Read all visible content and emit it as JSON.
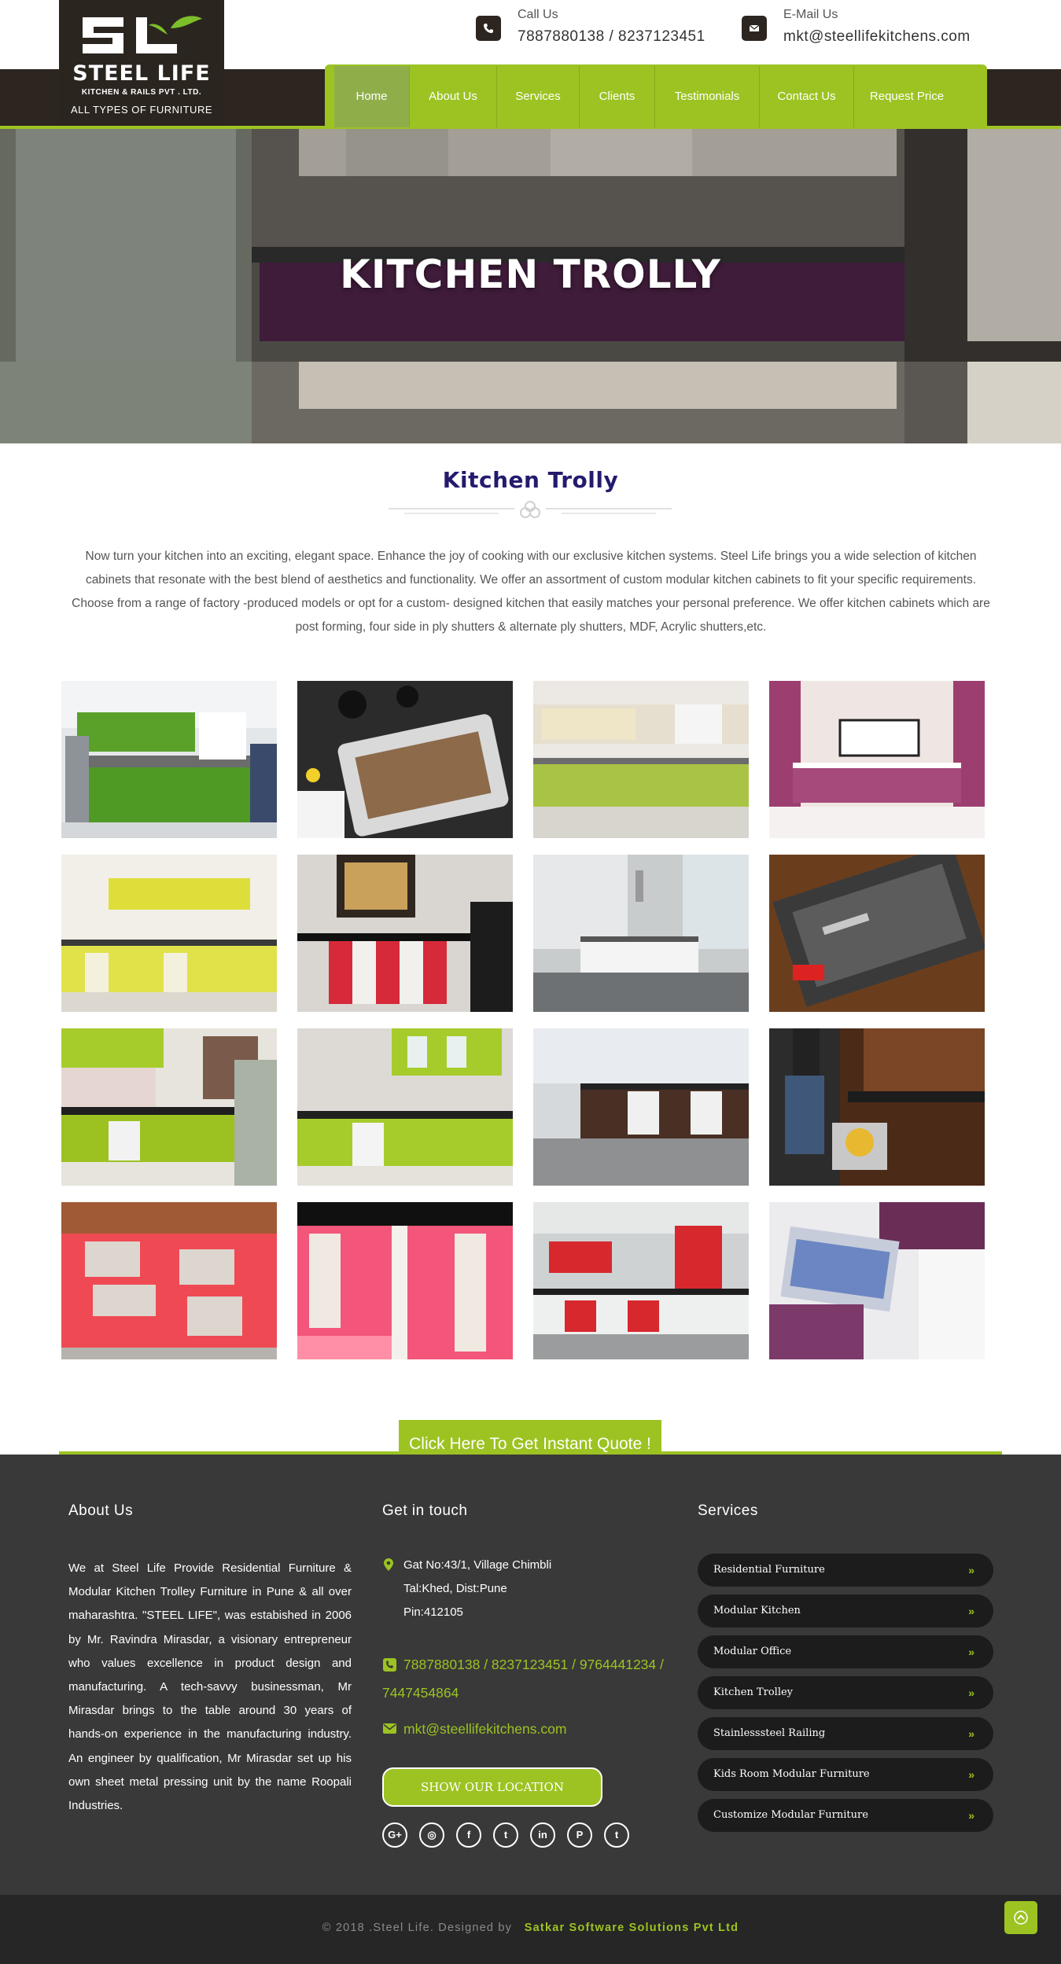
{
  "header": {
    "logo": {
      "mark": "SL",
      "name": "STEEL LIFE",
      "subtitle": "KITCHEN & RAILS PVT . LTD.",
      "tagline": "ALL TYPES OF FURNITURE"
    },
    "call": {
      "label": "Call Us",
      "value": "7887880138 / 8237123451",
      "icon": "phone-icon"
    },
    "email": {
      "label": "E-Mail Us",
      "value": "mkt@steellifekitchens.com",
      "icon": "envelope-icon"
    }
  },
  "nav": {
    "items": [
      {
        "label": "Home",
        "active": true
      },
      {
        "label": "About Us"
      },
      {
        "label": "Services"
      },
      {
        "label": "Clients"
      },
      {
        "label": "Testimonials"
      },
      {
        "label": "Contact Us"
      },
      {
        "label": "Request Price"
      }
    ]
  },
  "hero": {
    "title": "KITCHEN TROLLY"
  },
  "section": {
    "title": "Kitchen Trolly",
    "intro": "Now turn your kitchen into an exciting, elegant space. Enhance the joy of cooking with our exclusive kitchen systems. Steel Life brings you a wide selection of kitchen cabinets that resonate with the best blend of aesthetics and functionality. We offer an assortment of custom modular kitchen cabinets to fit your specific requirements. Choose from a range of factory -produced models or opt for a custom- designed kitchen that easily matches your personal preference. We offer kitchen cabinets which are post forming, four side in ply shutters & alternate ply shutters, MDF, Acrylic shutters,etc."
  },
  "gallery": {
    "count": 16
  },
  "cta": {
    "label": "Click Here To Get Instant Quote !"
  },
  "footer": {
    "about": {
      "title": "About Us",
      "text": "We at Steel Life Provide Residential Furniture & Modular Kitchen Trolley Furniture in Pune & all over maharashtra. \"STEEL LIFE\", was estabished in 2006 by Mr. Ravindra Mirasdar, a visionary entrepreneur who values excellence in product design and manufacturing. A tech-savvy businessman, Mr Mirasdar brings to the table around 30 years of hands-on experience in the manufacturing industry. An engineer by qualification, Mr Mirasdar set up his own sheet metal pressing unit by the name Roopali Industries."
    },
    "contact": {
      "title": "Get in touch",
      "address": [
        "Gat No:43/1, Village Chimbli",
        "Tal:Khed, Dist:Pune",
        "Pin:412105"
      ],
      "phones_line1": "7887880138 / 8237123451 / 9764441234 /",
      "phones_line2": "7447454864",
      "email": "mkt@steellifekitchens.com",
      "location_button": "SHOW OUR LOCATION",
      "social": [
        {
          "icon": "google-plus-icon",
          "glyph": "G+"
        },
        {
          "icon": "instagram-icon",
          "glyph": "◎"
        },
        {
          "icon": "facebook-icon",
          "glyph": "f"
        },
        {
          "icon": "twitter-icon",
          "glyph": "t"
        },
        {
          "icon": "linkedin-icon",
          "glyph": "in"
        },
        {
          "icon": "pinterest-icon",
          "glyph": "P"
        },
        {
          "icon": "tumblr-icon",
          "glyph": "t"
        }
      ]
    },
    "services": {
      "title": "Services",
      "items": [
        "Residential Furniture",
        "Modular Kitchen",
        "Modular Office",
        "Kitchen Trolley",
        "Stainlesssteel Railing",
        "Kids Room Modular Furniture",
        "Customize Modular Furniture"
      ],
      "chevron": "»"
    },
    "copyright": {
      "text": "© 2018 .Steel Life. Designed by",
      "company": "Satkar Software Solutions Pvt Ltd"
    }
  },
  "colors": {
    "accent": "#9cc322",
    "dark": "#2d251f",
    "title": "#231b6e",
    "footer": "#393939"
  }
}
